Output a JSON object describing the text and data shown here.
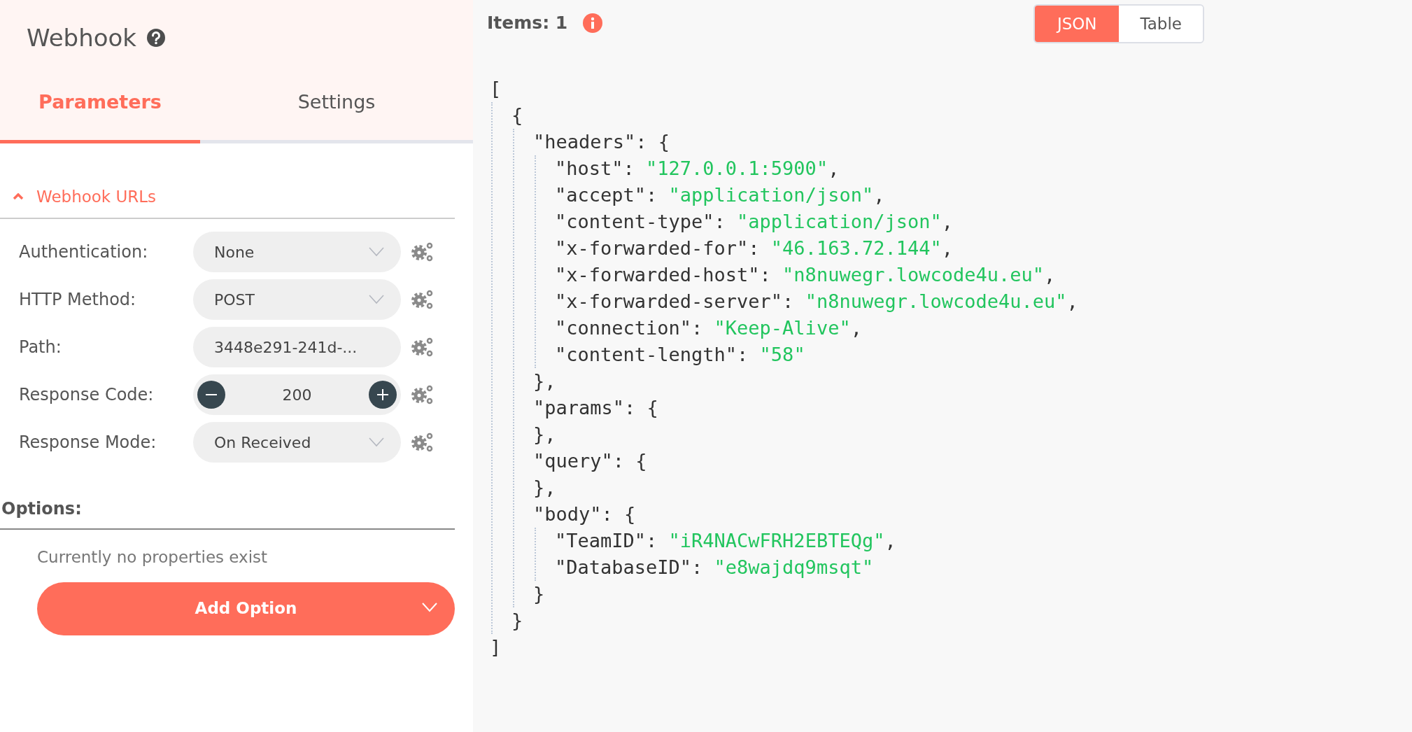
{
  "node": {
    "title": "Webhook"
  },
  "tabs": [
    {
      "label": "Parameters",
      "selected": true
    },
    {
      "label": "Settings",
      "selected": false
    }
  ],
  "section": {
    "title": "Webhook URLs",
    "expanded": false
  },
  "fields": [
    {
      "label": "Authentication:",
      "kind": "select",
      "value": "None"
    },
    {
      "label": "HTTP Method:",
      "kind": "select",
      "value": "POST"
    },
    {
      "label": "Path:",
      "kind": "text",
      "value": "3448e291-241d-..."
    },
    {
      "label": "Response Code:",
      "kind": "number",
      "value": "200"
    },
    {
      "label": "Response Mode:",
      "kind": "select",
      "value": "On Received"
    }
  ],
  "options": {
    "title": "Options:",
    "empty_text": "Currently no properties exist",
    "add_button": "Add Option"
  },
  "output": {
    "items_label": "Items: 1",
    "view_toggle": [
      {
        "label": "JSON",
        "selected": true
      },
      {
        "label": "Table",
        "selected": false
      }
    ],
    "json_view": {
      "open": "[",
      "close": "]",
      "children": [
        {
          "open": "{",
          "close": "}",
          "children": [
            {
              "key": "\"headers\":",
              "open": "{",
              "close": "},",
              "children": [
                {
                  "key": "\"host\":",
                  "value": "\"127.0.0.1:5900\"",
                  "tail": ","
                },
                {
                  "key": "\"accept\":",
                  "value": "\"application/json\"",
                  "tail": ","
                },
                {
                  "key": "\"content-type\":",
                  "value": "\"application/json\"",
                  "tail": ","
                },
                {
                  "key": "\"x-forwarded-for\":",
                  "value": "\"46.163.72.144\"",
                  "tail": ","
                },
                {
                  "key": "\"x-forwarded-host\":",
                  "value": "\"n8nuwegr.lowcode4u.eu\"",
                  "tail": ","
                },
                {
                  "key": "\"x-forwarded-server\":",
                  "value": "\"n8nuwegr.lowcode4u.eu\"",
                  "tail": ","
                },
                {
                  "key": "\"connection\":",
                  "value": "\"Keep-Alive\"",
                  "tail": ","
                },
                {
                  "key": "\"content-length\":",
                  "value": "\"58\""
                }
              ]
            },
            {
              "key": "\"params\":",
              "open": "{",
              "close": "},"
            },
            {
              "key": "\"query\":",
              "open": "{",
              "close": "},"
            },
            {
              "key": "\"body\":",
              "open": "{",
              "close": "}",
              "children": [
                {
                  "key": "\"TeamID\":",
                  "value": "\"iR4NACwFRH2EBTEQg\"",
                  "tail": ","
                },
                {
                  "key": "\"DatabaseID\":",
                  "value": "\"e8wajdq9msqt\""
                }
              ]
            }
          ]
        }
      ]
    }
  }
}
